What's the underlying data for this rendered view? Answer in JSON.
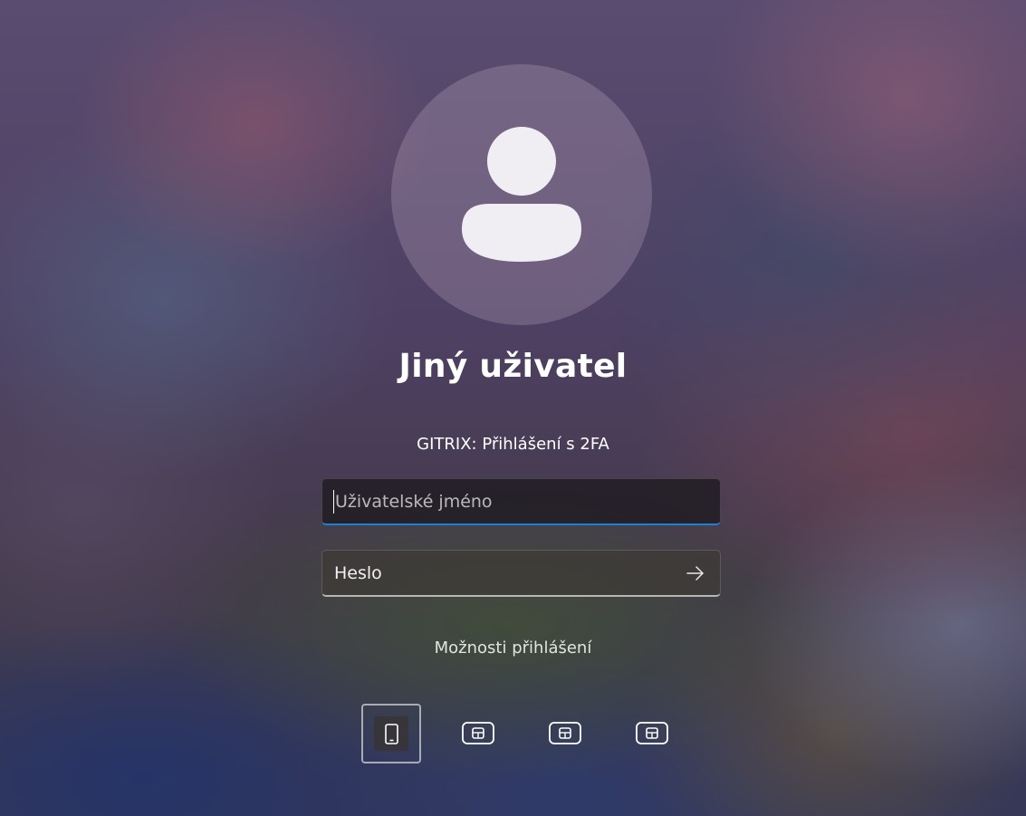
{
  "login": {
    "user_name": "Jiný uživatel",
    "subtitle": "GITRIX: Přihlášení s 2FA",
    "username_placeholder": "Uživatelské jméno",
    "password_placeholder": "Heslo",
    "sign_in_options_label": "Možnosti přihlášení"
  },
  "sign_in_options": [
    {
      "icon": "phone-icon",
      "selected": true
    },
    {
      "icon": "security-key-icon",
      "selected": false
    },
    {
      "icon": "security-key-icon",
      "selected": false
    },
    {
      "icon": "security-key-icon",
      "selected": false
    }
  ],
  "colors": {
    "focus_accent": "#1e7fd6",
    "text": "#ffffff"
  }
}
